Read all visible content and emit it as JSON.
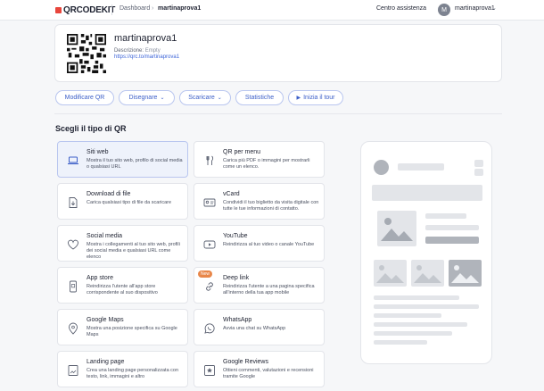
{
  "topbar": {
    "logo": "QRCODEKIT",
    "breadcrumbs": [
      "Dashboard",
      "martinaprova1"
    ],
    "help": "Centro assistenza",
    "avatar_letter": "M",
    "username": "martinaprova1"
  },
  "qr": {
    "name": "martinaprova1",
    "description_label": "Descrizione:",
    "description_value": "Empty",
    "link": "https://qrc.to/martinaprova1"
  },
  "actions": [
    {
      "label": "Modificare QR"
    },
    {
      "label": "Disegnare"
    },
    {
      "label": "Scaricare"
    },
    {
      "label": "Statistiche"
    },
    {
      "label": "Inizia il tour"
    }
  ],
  "section_title": "Scegli il tipo di QR",
  "types": [
    {
      "title": "Siti web",
      "desc": "Mostra il tuo sito web, profilo di social media o qualsiasi URL",
      "icon": "laptop-icon"
    },
    {
      "title": "QR per menu",
      "desc": "Carica più PDF o immagini per mostrarli come un elenco.",
      "icon": "cutlery-icon"
    },
    {
      "title": "Download di file",
      "desc": "Carica qualsiasi tipo di file da scaricare",
      "icon": "file-download-icon"
    },
    {
      "title": "vCard",
      "desc": "Condividi il tuo biglietto da visita digitale con tutte le tue informazioni di contatto.",
      "icon": "contact-card-icon"
    },
    {
      "title": "Social media",
      "desc": "Mostra i collegamenti al tuo sito web, profili dei social media e qualsiasi URL come elenco",
      "icon": "heart-icon"
    },
    {
      "title": "YouTube",
      "desc": "Reindirizza al tuo video o canale YouTube",
      "icon": "youtube-icon"
    },
    {
      "title": "App store",
      "desc": "Reindirizza l'utente all'app store corrispondente al suo dispositivo",
      "icon": "phone-app-icon"
    },
    {
      "title": "Deep link",
      "desc": "Reindirizza l'utente a una pagina specifica all'interno della tua app mobile",
      "icon": "link-icon",
      "badge": "New"
    },
    {
      "title": "Google Maps",
      "desc": "Mostra una posizione specifica su Google Maps",
      "icon": "map-pin-icon"
    },
    {
      "title": "WhatsApp",
      "desc": "Avvia una chat su WhatsApp",
      "icon": "whatsapp-icon"
    },
    {
      "title": "Landing page",
      "desc": "Crea una landing page personalizzata con testo, link, immagini e altro",
      "icon": "landing-page-icon"
    },
    {
      "title": "Google Reviews",
      "desc": "Ottieni commenti, valutazioni e recensioni tramite Google",
      "icon": "review-star-icon"
    }
  ],
  "colors": {
    "accent": "#3c5fc8",
    "logo_red": "#e8463c",
    "selected_bg": "#eef2fb",
    "badge": "#e8874a"
  }
}
